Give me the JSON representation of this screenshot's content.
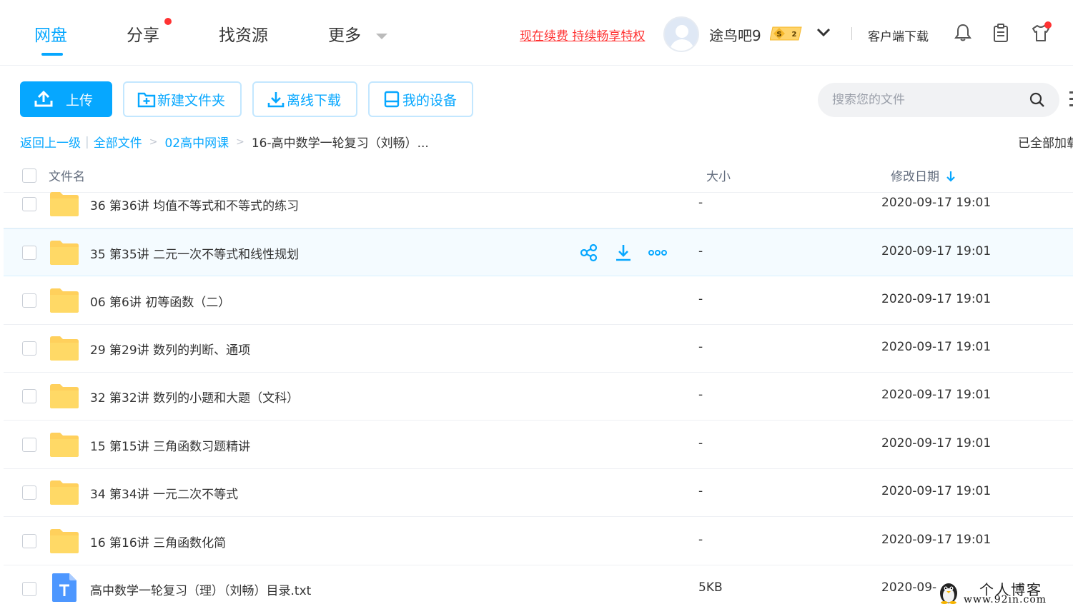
{
  "nav": {
    "tabs": [
      {
        "label": "网盘",
        "active": true
      },
      {
        "label": "分享",
        "has_dot": true
      },
      {
        "label": "找资源"
      },
      {
        "label": "更多",
        "has_dropdown": true
      }
    ],
    "renew_link": "现在续费 持续畅享特权",
    "username": "途鸟吧9",
    "vip_level": "2",
    "client_download": "客户端下载",
    "icons": [
      "bell-icon",
      "clipboard-icon",
      "tshirt-icon"
    ]
  },
  "toolbar": {
    "upload": "上传",
    "new_folder": "新建文件夹",
    "offline_download": "离线下载",
    "my_devices": "我的设备",
    "search_placeholder": "搜索您的文件"
  },
  "breadcrumb": {
    "back": "返回上一级",
    "all_files": "全部文件",
    "parent": "02高中网课",
    "current": "16-高中数学一轮复习（刘畅）...",
    "status": "已全部加载"
  },
  "table": {
    "col_name": "文件名",
    "col_size": "大小",
    "col_date": "修改日期"
  },
  "files": [
    {
      "name": "36 第36讲 均值不等式和不等式的练习",
      "size": "-",
      "date": "2020-09-17 19:01",
      "type": "folder"
    },
    {
      "name": "35 第35讲 二元一次不等式和线性规划",
      "size": "-",
      "date": "2020-09-17 19:01",
      "type": "folder",
      "hovered": true
    },
    {
      "name": "06 第6讲 初等函数（二）",
      "size": "-",
      "date": "2020-09-17 19:01",
      "type": "folder"
    },
    {
      "name": "29 第29讲 数列的判断、通项",
      "size": "-",
      "date": "2020-09-17 19:01",
      "type": "folder"
    },
    {
      "name": "32 第32讲 数列的小题和大题（文科）",
      "size": "-",
      "date": "2020-09-17 19:01",
      "type": "folder"
    },
    {
      "name": "15 第15讲 三角函数习题精讲",
      "size": "-",
      "date": "2020-09-17 19:01",
      "type": "folder"
    },
    {
      "name": "34 第34讲 一元二次不等式",
      "size": "-",
      "date": "2020-09-17 19:01",
      "type": "folder"
    },
    {
      "name": "16 第16讲 三角函数化简",
      "size": "-",
      "date": "2020-09-17 19:01",
      "type": "folder"
    },
    {
      "name": "高中数学一轮复习（理）（刘畅）目录.txt",
      "size": "5KB",
      "date": "2020-09-",
      "type": "txt"
    }
  ],
  "watermark": {
    "title": "个人博客",
    "domain": "www.92in.com"
  },
  "colors": {
    "accent": "#06a7ff",
    "alert": "#ff3333",
    "folder": "#ffd05c"
  }
}
